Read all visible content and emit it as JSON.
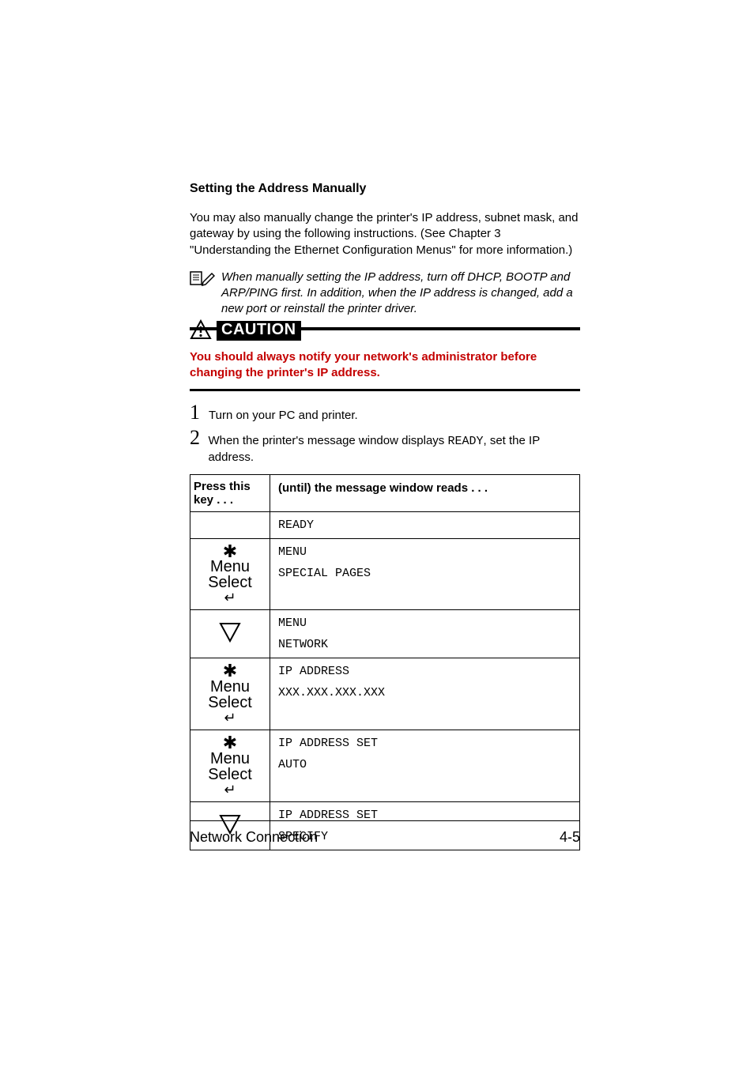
{
  "heading": "Setting the Address Manually",
  "intro": "You may also manually change the printer's IP address, subnet mask, and gateway by using the following instructions. (See Chapter 3 \"Understanding the Ethernet Configuration Menus\" for more information.)",
  "note": "When manually setting the IP address, turn off DHCP, BOOTP and ARP/PING first. In addition, when the IP address is changed, add a new port or reinstall the printer driver.",
  "caution_label": "CAUTION",
  "caution_text": "You should always notify your network's administrator before changing the printer's IP address.",
  "steps": [
    {
      "num": "1",
      "text": "Turn on your PC and printer."
    },
    {
      "num": "2",
      "prefix": "When the printer's message window displays ",
      "code": "READY",
      "suffix": ", set the IP address."
    }
  ],
  "table": {
    "head_key": "Press this key . . .",
    "head_msg": "(until) the message window reads  . . .",
    "rows": [
      {
        "key_type": "none",
        "lines": [
          "READY"
        ]
      },
      {
        "key_type": "menu",
        "lines": [
          "MENU",
          "SPECIAL PAGES"
        ]
      },
      {
        "key_type": "down",
        "lines": [
          "MENU",
          "NETWORK"
        ]
      },
      {
        "key_type": "menu",
        "lines": [
          "IP ADDRESS",
          "XXX.XXX.XXX.XXX"
        ]
      },
      {
        "key_type": "menu",
        "lines": [
          "IP ADDRESS SET",
          "AUTO"
        ]
      },
      {
        "key_type": "down",
        "lines": [
          "IP ADDRESS SET",
          "SPECIFY"
        ]
      }
    ],
    "menu_key": {
      "star": "✱",
      "menu": "Menu",
      "select": "Select",
      "enter": "↵"
    }
  },
  "footer": {
    "left": "Network Connection",
    "right": "4-5"
  }
}
